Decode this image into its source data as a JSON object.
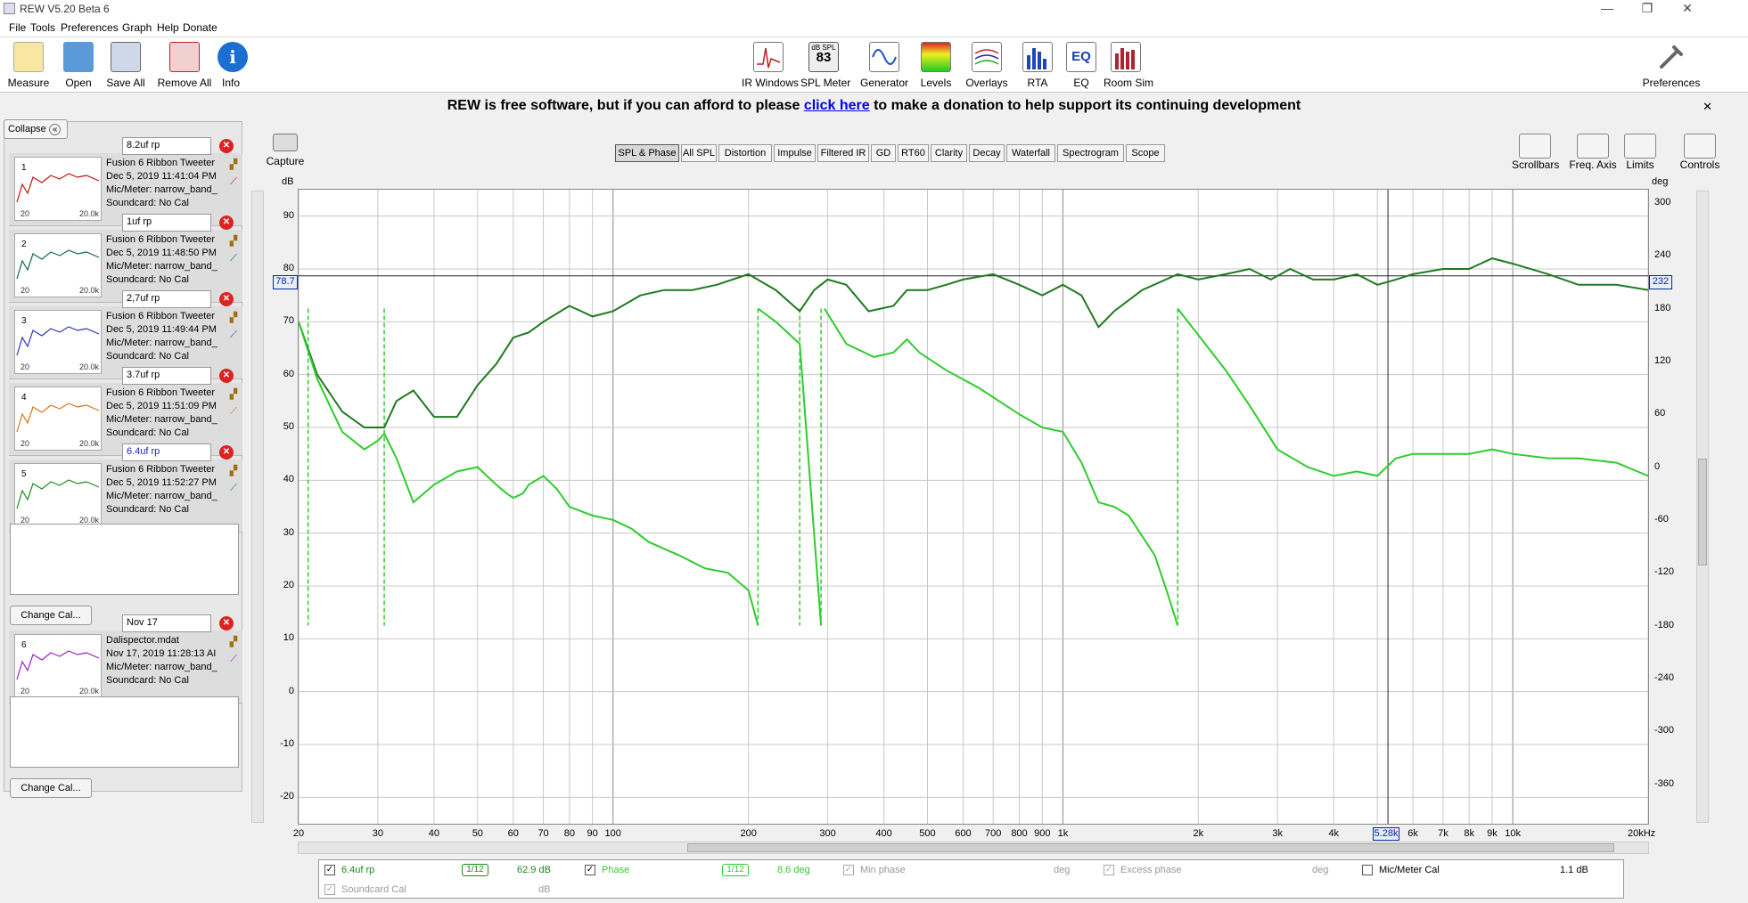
{
  "window": {
    "title": "REW V5.20 Beta 6",
    "min": "—",
    "max": "❐",
    "close": "✕"
  },
  "menu": [
    "File",
    "Tools",
    "Preferences",
    "Graph",
    "Help",
    "Donate"
  ],
  "toolbar_left": [
    {
      "label": "Measure",
      "icon": "measure-icon"
    },
    {
      "label": "Open",
      "icon": "folder-icon"
    },
    {
      "label": "Save All",
      "icon": "save-icon"
    },
    {
      "label": "Remove All",
      "icon": "remove-all-icon"
    },
    {
      "label": "Info",
      "icon": "info-icon"
    }
  ],
  "toolbar_center": [
    {
      "label": "IR Windows",
      "icon": "ir-windows-icon"
    },
    {
      "label": "SPL Meter",
      "icon": "spl-meter-icon",
      "badge_top": "dB SPL",
      "badge": "83"
    },
    {
      "label": "Generator",
      "icon": "generator-icon"
    },
    {
      "label": "Levels",
      "icon": "levels-icon"
    },
    {
      "label": "Overlays",
      "icon": "overlays-icon"
    },
    {
      "label": "RTA",
      "icon": "rta-icon"
    },
    {
      "label": "EQ",
      "icon": "eq-icon",
      "badge": "EQ"
    },
    {
      "label": "Room Sim",
      "icon": "room-sim-icon"
    }
  ],
  "toolbar_right": {
    "label": "Preferences",
    "icon": "preferences-icon"
  },
  "donate": {
    "prefix": "REW is free software, but if you can afford to please ",
    "link": "click here",
    "suffix": " to make a donation to help support its continuing development",
    "close": "✕"
  },
  "panel": {
    "collapse": "Collapse",
    "change_cal": "Change Cal..."
  },
  "measurements": [
    {
      "num": "1",
      "name": "8.2uf rp",
      "title": "Fusion 6 Ribbon Tweeter",
      "date": "Dec 5, 2019 11:41:04 PM",
      "mic": "Mic/Meter: narrow_band_",
      "sound": "Soundcard: No Cal",
      "color": "#c01010",
      "thumb_lo": "20",
      "thumb_hi": "20.0k"
    },
    {
      "num": "2",
      "name": "1uf rp",
      "title": "Fusion 6 Ribbon Tweeter",
      "date": "Dec 5, 2019 11:48:50 PM",
      "mic": "Mic/Meter: narrow_band_",
      "sound": "Soundcard: No Cal",
      "color": "#0a6a3a",
      "thumb_lo": "20",
      "thumb_hi": "20.0k"
    },
    {
      "num": "3",
      "name": "2,7uf rp",
      "title": "Fusion 6 Ribbon Tweeter",
      "date": "Dec 5, 2019 11:49:44 PM",
      "mic": "Mic/Meter: narrow_band_",
      "sound": "Soundcard: No Cal",
      "color": "#3030c0",
      "thumb_lo": "20",
      "thumb_hi": "20.0k"
    },
    {
      "num": "4",
      "name": "3.7uf rp",
      "title": "Fusion 6 Ribbon Tweeter",
      "date": "Dec 5, 2019 11:51:09 PM",
      "mic": "Mic/Meter: narrow_band_",
      "sound": "Soundcard: No Cal",
      "color": "#e07010",
      "thumb_lo": "20",
      "thumb_hi": "20.0k"
    },
    {
      "num": "5",
      "name": "6.4uf rp",
      "title": "Fusion 6 Ribbon Tweeter",
      "date": "Dec 5, 2019 11:52:27 PM",
      "mic": "Mic/Meter: narrow_band_",
      "sound": "Soundcard: No Cal",
      "color": "#1a8a1a",
      "thumb_lo": "20",
      "thumb_hi": "20.0k"
    },
    {
      "num": "6",
      "name": "Nov 17",
      "title": "Dalispector.mdat",
      "date": "Nov 17, 2019 11:28:13 AI",
      "mic": "Mic/Meter: narrow_band_",
      "sound": "Soundcard: No Cal",
      "color": "#9a20c0",
      "thumb_lo": "20",
      "thumb_hi": "20.0k"
    }
  ],
  "capture": "Capture",
  "tabs": [
    "SPL & Phase",
    "All SPL",
    "Distortion",
    "Impulse",
    "Filtered IR",
    "GD",
    "RT60",
    "Clarity",
    "Decay",
    "Waterfall",
    "Spectrogram",
    "Scope"
  ],
  "selected_tab": "SPL & Phase",
  "right_tools": [
    {
      "label": "Scrollbars",
      "icon": "scrollbars-icon"
    },
    {
      "label": "Freq. Axis",
      "icon": "freq-axis-icon"
    },
    {
      "label": "Limits",
      "icon": "limits-icon"
    },
    {
      "label": "Controls",
      "icon": "controls-icon"
    }
  ],
  "axis": {
    "y_left_unit": "dB",
    "y_right_unit": "deg",
    "cursor_left": "78.7",
    "cursor_right": "232",
    "cursor_freq": "5.28k",
    "y_left_ticks": [
      "90",
      "80",
      "70",
      "60",
      "50",
      "40",
      "30",
      "20",
      "10",
      "0",
      "-10",
      "-20"
    ],
    "y_right_ticks": [
      "300",
      "240",
      "180",
      "120",
      "60",
      "0",
      "-60",
      "-120",
      "-180",
      "-240",
      "-300",
      "-360"
    ],
    "x_ticks": [
      "20",
      "30",
      "40",
      "50",
      "60",
      "70",
      "80",
      "90",
      "100",
      "200",
      "300",
      "400",
      "500",
      "600",
      "700",
      "800",
      "900",
      "1k",
      "2k",
      "3k",
      "4k",
      "5k",
      "6k",
      "7k",
      "8k",
      "9k",
      "10k",
      "20kHz"
    ]
  },
  "legend": {
    "m_name": "6.4uf rp",
    "m_smooth": "1/12",
    "m_value": "62.9 dB",
    "phase": "Phase",
    "p_smooth": "1/12",
    "p_value": "8.6 deg",
    "min_phase": "Min phase",
    "min_unit": "deg",
    "excess": "Excess phase",
    "excess_unit": "deg",
    "miccal": "Mic/Meter Cal",
    "miccal_value": "1.1 dB",
    "sndcal": "Soundcard Cal",
    "snd_unit": "dB"
  },
  "chart_data": {
    "type": "line",
    "x_scale": "log",
    "xlim": [
      20,
      20000
    ],
    "ylim": [
      -25,
      95
    ],
    "y2lim": [
      -405,
      315
    ],
    "series": [
      {
        "name": "6.4uf rp",
        "axis": "left",
        "color": "#1f7a1f",
        "points": [
          [
            20,
            70
          ],
          [
            22,
            60
          ],
          [
            25,
            53
          ],
          [
            28,
            50
          ],
          [
            31,
            50
          ],
          [
            33,
            55
          ],
          [
            36,
            57
          ],
          [
            40,
            52
          ],
          [
            45,
            52
          ],
          [
            50,
            58
          ],
          [
            55,
            62
          ],
          [
            60,
            67
          ],
          [
            65,
            68
          ],
          [
            70,
            70
          ],
          [
            80,
            73
          ],
          [
            85,
            72
          ],
          [
            90,
            71
          ],
          [
            100,
            72
          ],
          [
            115,
            75
          ],
          [
            130,
            76
          ],
          [
            150,
            76
          ],
          [
            170,
            77
          ],
          [
            200,
            79
          ],
          [
            230,
            76
          ],
          [
            260,
            72
          ],
          [
            280,
            76
          ],
          [
            300,
            78
          ],
          [
            330,
            77
          ],
          [
            370,
            72
          ],
          [
            420,
            73
          ],
          [
            450,
            76
          ],
          [
            500,
            76
          ],
          [
            550,
            77
          ],
          [
            600,
            78
          ],
          [
            700,
            79
          ],
          [
            800,
            77
          ],
          [
            900,
            75
          ],
          [
            1000,
            77
          ],
          [
            1100,
            75
          ],
          [
            1200,
            69
          ],
          [
            1300,
            72
          ],
          [
            1500,
            76
          ],
          [
            1800,
            79
          ],
          [
            2000,
            78
          ],
          [
            2300,
            79
          ],
          [
            2600,
            80
          ],
          [
            2900,
            78
          ],
          [
            3200,
            80
          ],
          [
            3600,
            78
          ],
          [
            4000,
            78
          ],
          [
            4500,
            79
          ],
          [
            5000,
            77
          ],
          [
            5500,
            78
          ],
          [
            6000,
            79
          ],
          [
            7000,
            80
          ],
          [
            8000,
            80
          ],
          [
            9000,
            82
          ],
          [
            10000,
            81
          ],
          [
            12000,
            79
          ],
          [
            14000,
            77
          ],
          [
            17000,
            77
          ],
          [
            20000,
            76
          ]
        ]
      },
      {
        "name": "Phase",
        "axis": "right",
        "color": "#2ecc2e",
        "points": [
          [
            20,
            165
          ],
          [
            22,
            100
          ],
          [
            25,
            40
          ],
          [
            28,
            20
          ],
          [
            30,
            30
          ],
          [
            31,
            38
          ],
          [
            33,
            10
          ],
          [
            36,
            -40
          ],
          [
            40,
            -20
          ],
          [
            45,
            -5
          ],
          [
            50,
            0
          ],
          [
            55,
            -20
          ],
          [
            58,
            -30
          ],
          [
            60,
            -35
          ],
          [
            63,
            -30
          ],
          [
            65,
            -20
          ],
          [
            70,
            -10
          ],
          [
            75,
            -25
          ],
          [
            80,
            -45
          ],
          [
            90,
            -55
          ],
          [
            100,
            -60
          ],
          [
            110,
            -70
          ],
          [
            120,
            -85
          ],
          [
            140,
            -100
          ],
          [
            160,
            -115
          ],
          [
            180,
            -120
          ],
          [
            200,
            -140
          ],
          [
            210,
            -180
          ]
        ]
      },
      {
        "name": "Phase-2",
        "axis": "right",
        "color": "#2ecc2e",
        "points": [
          [
            210,
            180
          ],
          [
            230,
            165
          ],
          [
            260,
            140
          ],
          [
            290,
            -180
          ]
        ]
      },
      {
        "name": "Phase-3",
        "axis": "right",
        "color": "#2ecc2e",
        "points": [
          [
            295,
            180
          ],
          [
            330,
            140
          ],
          [
            380,
            125
          ],
          [
            420,
            130
          ],
          [
            450,
            145
          ],
          [
            480,
            130
          ],
          [
            550,
            110
          ],
          [
            650,
            90
          ],
          [
            800,
            60
          ],
          [
            900,
            45
          ],
          [
            1000,
            40
          ],
          [
            1100,
            5
          ],
          [
            1200,
            -40
          ],
          [
            1300,
            -45
          ],
          [
            1400,
            -55
          ],
          [
            1600,
            -100
          ],
          [
            1700,
            -140
          ],
          [
            1800,
            -180
          ]
        ]
      },
      {
        "name": "Phase-4",
        "axis": "right",
        "color": "#2ecc2e",
        "points": [
          [
            1800,
            180
          ],
          [
            2000,
            150
          ],
          [
            2300,
            110
          ],
          [
            2600,
            70
          ],
          [
            3000,
            20
          ],
          [
            3500,
            0
          ],
          [
            4000,
            -10
          ],
          [
            4500,
            -5
          ],
          [
            5000,
            -10
          ],
          [
            5500,
            10
          ],
          [
            6000,
            15
          ],
          [
            7000,
            15
          ],
          [
            8000,
            15
          ],
          [
            9000,
            20
          ],
          [
            10000,
            15
          ],
          [
            12000,
            10
          ],
          [
            14000,
            10
          ],
          [
            17000,
            5
          ],
          [
            20000,
            -10
          ]
        ]
      }
    ]
  }
}
